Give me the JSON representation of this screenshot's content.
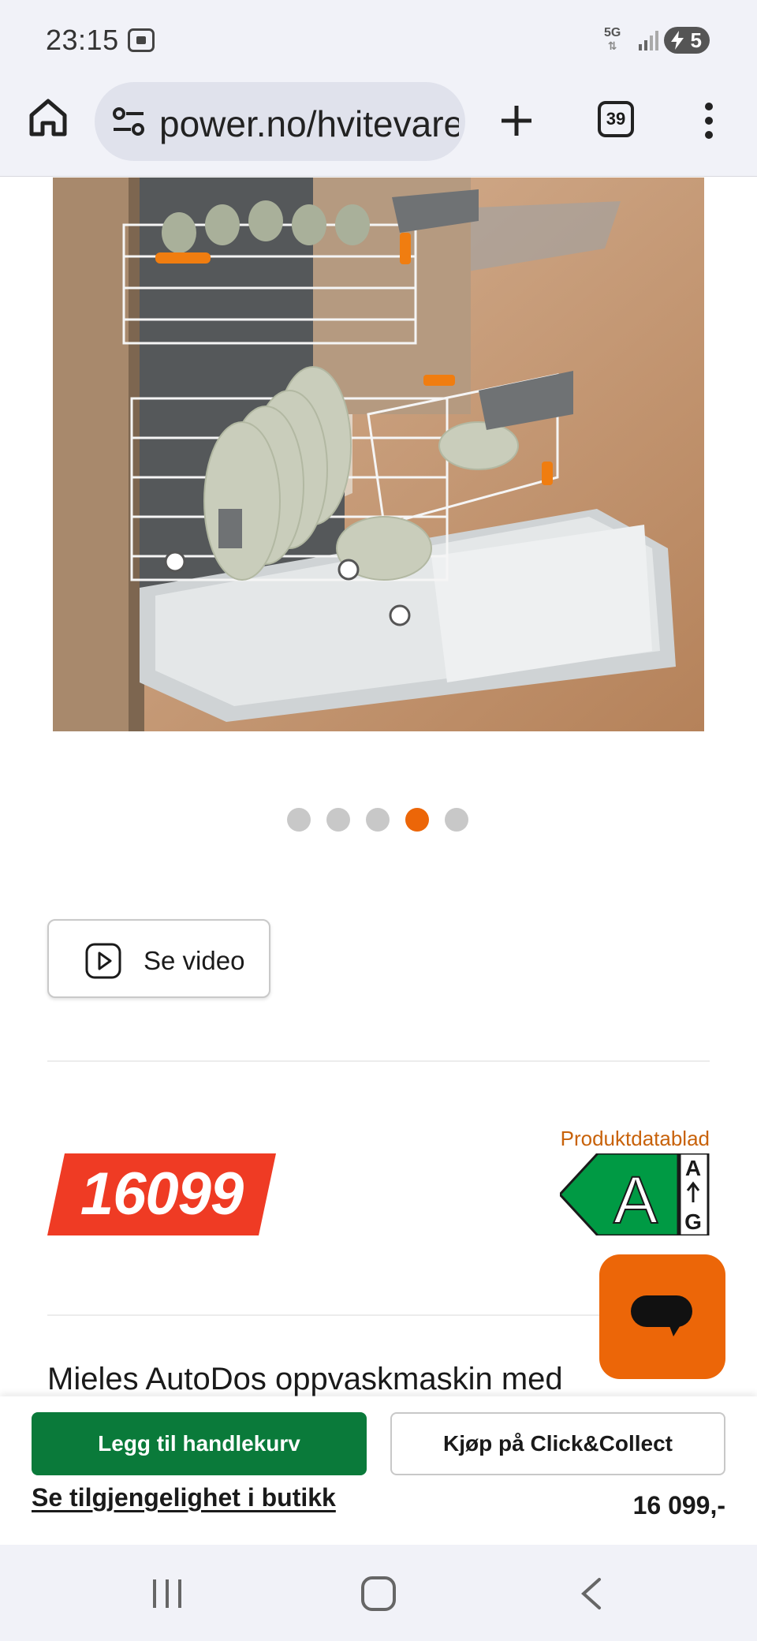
{
  "status_bar": {
    "time": "23:15",
    "network": "5G",
    "battery": "5"
  },
  "browser": {
    "url": "power.no/hvitevarer",
    "tab_count": "39"
  },
  "carousel": {
    "total": 5,
    "active_index": 3
  },
  "video_button": {
    "label": "Se video"
  },
  "price": {
    "amount": "16099",
    "color": "#ef3b24"
  },
  "energy": {
    "datasheet_label": "Produktdatablad",
    "class": "A",
    "scale_top": "A",
    "scale_bottom": "G",
    "color": "#009a44"
  },
  "product": {
    "title": "Mieles AutoDos oppvaskmaskin med"
  },
  "actions": {
    "cart_label": "Legg til handlekurv",
    "collect_label": "Kjøp på Click&Collect",
    "availability_label": "Se tilgjengelighet i butikk",
    "price_label": "16 099,-"
  },
  "colors": {
    "brand_orange": "#ec6608",
    "cart_green": "#0a7a3a"
  }
}
